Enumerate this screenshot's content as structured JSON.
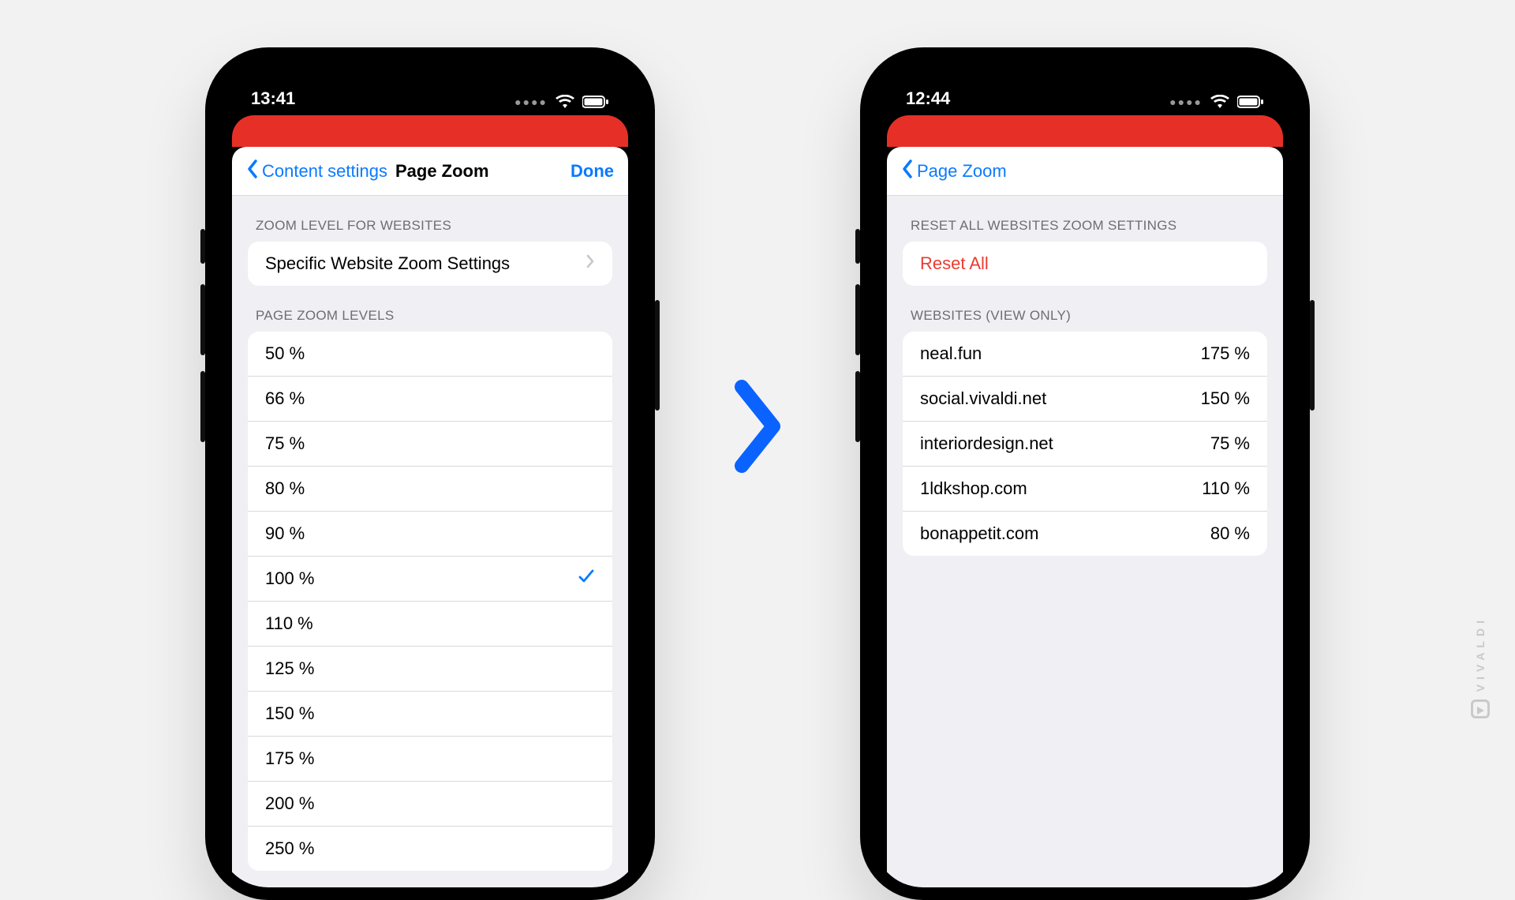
{
  "watermark": "VIVALDI",
  "phone_left": {
    "time": "13:41",
    "nav": {
      "back_label": "Content settings",
      "title": "Page Zoom",
      "done_label": "Done"
    },
    "section1": {
      "header": "ZOOM LEVEL FOR WEBSITES",
      "row_label": "Specific Website Zoom Settings"
    },
    "section2": {
      "header": "PAGE ZOOM LEVELS",
      "levels": [
        "50 %",
        "66 %",
        "75 %",
        "80 %",
        "90 %",
        "100 %",
        "110 %",
        "125 %",
        "150 %",
        "175 %",
        "200 %",
        "250 %"
      ],
      "selected": "100 %"
    }
  },
  "phone_right": {
    "time": "12:44",
    "nav": {
      "back_label": "Page Zoom"
    },
    "section1": {
      "header": "RESET ALL WEBSITES ZOOM SETTINGS",
      "reset_label": "Reset All"
    },
    "section2": {
      "header": "WEBSITES (VIEW ONLY)",
      "sites": [
        {
          "host": "neal.fun",
          "zoom": "175 %"
        },
        {
          "host": "social.vivaldi.net",
          "zoom": "150 %"
        },
        {
          "host": "interiordesign.net",
          "zoom": "75 %"
        },
        {
          "host": "1ldkshop.com",
          "zoom": "110 %"
        },
        {
          "host": "bonappetit.com",
          "zoom": "80 %"
        }
      ]
    }
  }
}
